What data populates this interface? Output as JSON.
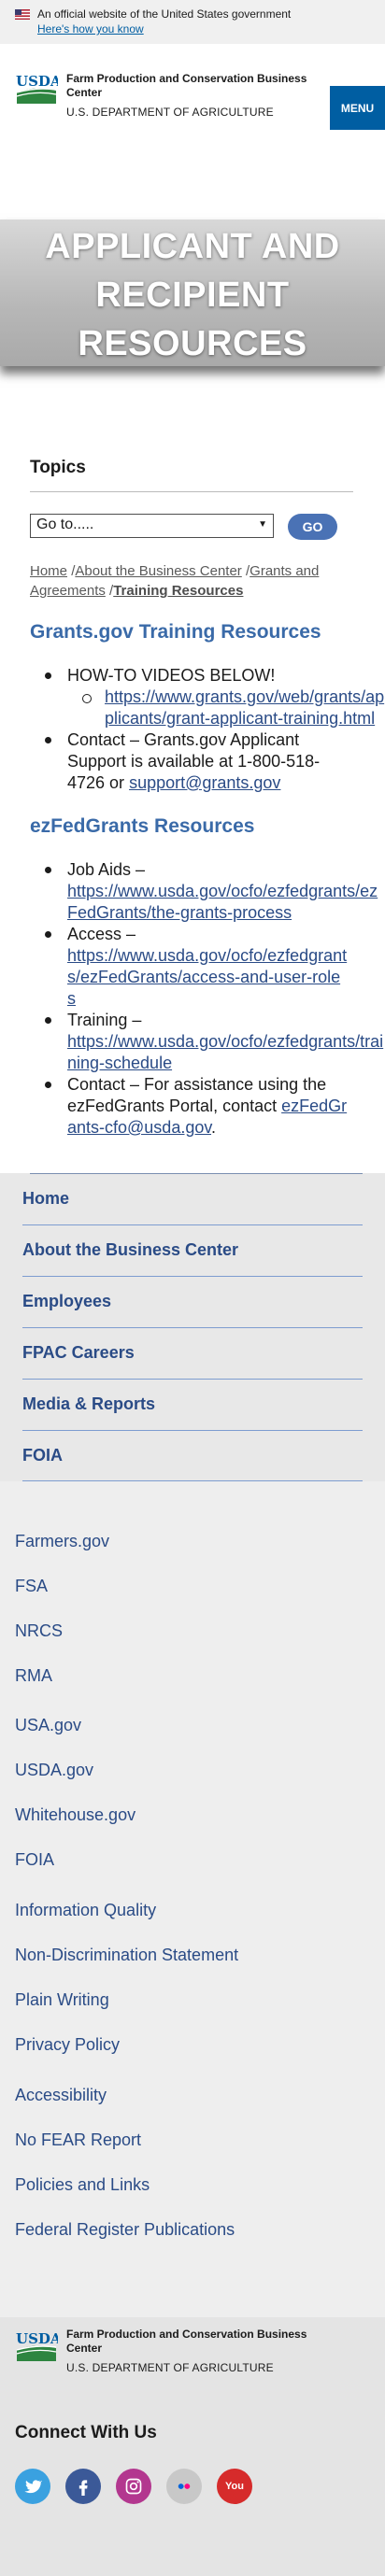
{
  "gov_banner": {
    "text": "An official website of the United States government",
    "link": "Here's how you know"
  },
  "header": {
    "logo_text": "USDA",
    "agency": "Farm Production and Conservation Business Center",
    "department": "U.S. DEPARTMENT OF AGRICULTURE",
    "menu_label": "MENU"
  },
  "hero": {
    "title_line1": "APPLICANT AND",
    "title_line2": "RECIPIENT",
    "title_line3": "RESOURCES"
  },
  "topics": {
    "heading": "Topics",
    "select_value": "Go to.....",
    "go_label": "GO"
  },
  "breadcrumb": {
    "items": [
      "Home",
      "About the Business Center",
      "Grants and Agreements"
    ],
    "separator": "/",
    "current": "Training Resources"
  },
  "grants_section": {
    "heading": "Grants.gov Training Resources",
    "item1": "HOW-TO VIDEOS BELOW!",
    "item1_sub_link": "https://www.grants.gov/web/grants/applicants/grant-applicant-training.html",
    "item2_text": "Contact – Grants.gov Applicant Support is available at 1-800-518-4726 or ",
    "item2_link": "support@grants.gov"
  },
  "ezfed_section": {
    "heading": "ezFedGrants Resources",
    "item1_label": "Job Aids – ",
    "item1_link": "https://www.usda.gov/ocfo/ezfedgrants/ezFedGrants/the-grants-process",
    "item2_label": "Access – ",
    "item2_link": "https://www.usda.gov/ocfo/ezfedgrants/ezFedGrants/access-and-user-roles",
    "item3_label": "Training – ",
    "item3_link": "https://www.usda.gov/ocfo/ezfedgrants/training-schedule",
    "item4_text": "Contact – For assistance using the ezFedGrants Portal, contact ",
    "item4_link": "ezFedGrants-cfo@usda.gov",
    "item4_end": "."
  },
  "footer_nav": {
    "items": [
      "Home",
      "About the Business Center",
      "Employees",
      "FPAC Careers",
      "Media & Reports",
      "FOIA"
    ]
  },
  "footer_links": {
    "group1": [
      "Farmers.gov",
      "FSA",
      "NRCS",
      "RMA"
    ],
    "group2": [
      "USA.gov",
      "USDA.gov",
      "Whitehouse.gov",
      "FOIA"
    ],
    "group3": [
      "Information Quality",
      "Non-Discrimination Statement",
      "Plain Writing",
      "Privacy Policy"
    ],
    "group4": [
      "Accessibility",
      "No FEAR Report",
      "Policies and Links",
      "Federal Register Publications"
    ]
  },
  "bottom_footer": {
    "logo_text": "USDA",
    "agency": "Farm Production and Conservation Business Center",
    "department": "U.S. DEPARTMENT OF AGRICULTURE",
    "connect": "Connect With Us",
    "social_icons": [
      "twitter-icon",
      "facebook-icon",
      "instagram-icon",
      "flickr-icon",
      "youtube-icon"
    ],
    "youtube_label": "You"
  },
  "colors": {
    "link": "#2a4b86",
    "heading_blue": "#3a6aa8",
    "menu_blue": "#005ea2",
    "go_button": "#4a72b5",
    "twitter": "#3aa1e0",
    "facebook": "#3b5998",
    "instagram": "#b3378f",
    "flickr": "#c8c8c8",
    "youtube": "#d62b2b"
  }
}
